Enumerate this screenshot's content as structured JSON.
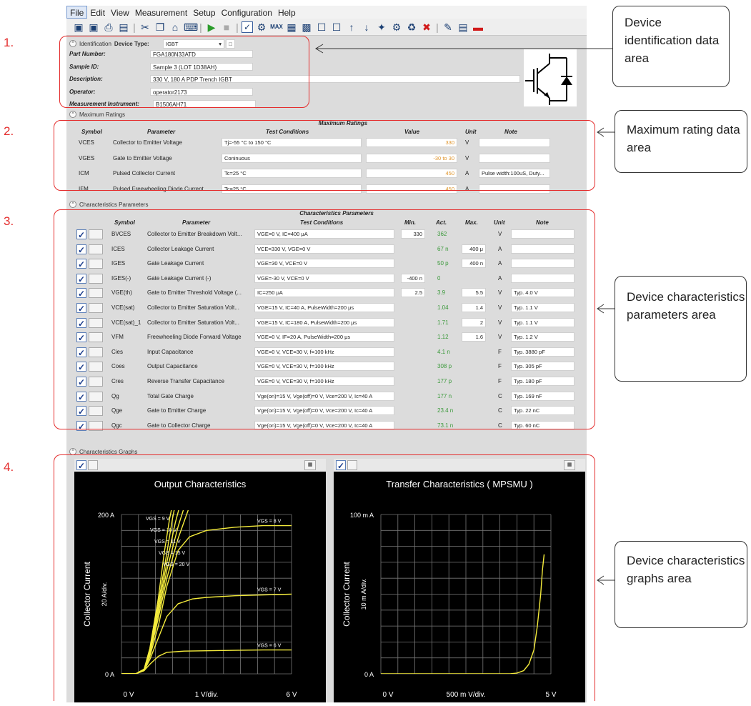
{
  "menu": [
    "File",
    "Edit",
    "View",
    "Measurement",
    "Setup",
    "Configuration",
    "Help"
  ],
  "toolbar_icons": [
    "save-icon",
    "save-as-icon",
    "print-icon",
    "open-icon",
    "cut-icon",
    "copy-icon",
    "paste-icon",
    "keyboard-icon",
    "run-icon",
    "stop-icon",
    "checkbox-icon",
    "settings-icon",
    "max-icon",
    "table-icon",
    "chart-icon",
    "export-icon",
    "import-icon",
    "up-arrow-icon",
    "down-arrow-icon",
    "wrench-icon",
    "config-icon",
    "refresh-icon",
    "delete-icon",
    "notes-icon",
    "document-icon",
    "color-icon"
  ],
  "identification": {
    "header": "Identification",
    "device_type_label": "Device Type:",
    "device_type_value": "IGBT",
    "fields": [
      {
        "label": "Part Number:",
        "value": "FGA180N33ATD"
      },
      {
        "label": "Sample ID:",
        "value": "Sample 3 (LOT 1D38AH)"
      },
      {
        "label": "Description:",
        "value": "330 V, 180 A PDP Trench IGBT"
      },
      {
        "label": "Operator:",
        "value": "operator2173"
      },
      {
        "label": "Measurement Instrument:",
        "value": "B1506AH71"
      }
    ]
  },
  "max_ratings": {
    "header": "Maximum Ratings",
    "title": "Maximum Ratings",
    "columns": [
      "Symbol",
      "Parameter",
      "Test Conditions",
      "Value",
      "Unit",
      "Note"
    ],
    "rows": [
      {
        "symbol": "VCES",
        "parameter": "Collector to Emitter Voltage",
        "conditions": "Tj=-55 °C to 150 °C",
        "value": "330",
        "unit": "V",
        "note": ""
      },
      {
        "symbol": "VGES",
        "parameter": "Gate to Emitter Voltage",
        "conditions": "Coninuous",
        "value": "-30  to 30",
        "unit": "V",
        "note": ""
      },
      {
        "symbol": "ICM",
        "parameter": "Pulsed Collector Current",
        "conditions": "Tc=25 °C",
        "value": "450",
        "unit": "A",
        "note": "Pulse width:100uS, Duty..."
      },
      {
        "symbol": "IFM",
        "parameter": "Pulsed Freewheeling Diode Current",
        "conditions": "Tc=25 °C",
        "value": "450",
        "unit": "A",
        "note": ""
      }
    ]
  },
  "char_params": {
    "header": "Characteristics Parameters",
    "title": "Characteristics Parameters",
    "columns": [
      "Symbol",
      "Parameter",
      "Test Conditions",
      "Min.",
      "Act.",
      "Max.",
      "Unit",
      "Note"
    ],
    "rows": [
      {
        "symbol": "BVCES",
        "parameter": "Collector to Emitter Breakdown Volt...",
        "conditions": "VGE=0 V, IC=400 μA",
        "min": "330",
        "act": "362",
        "max": "",
        "unit": "V",
        "note": ""
      },
      {
        "symbol": "ICES",
        "parameter": "Collector Leakage Current",
        "conditions": "VCE=330 V, VGE=0 V",
        "min": "",
        "act": "67 n",
        "max": "400 μ",
        "unit": "A",
        "note": ""
      },
      {
        "symbol": "IGES",
        "parameter": "Gate Leakage Current",
        "conditions": "VGE=30 V, VCE=0 V",
        "min": "",
        "act": "50 p",
        "max": "400 n",
        "unit": "A",
        "note": ""
      },
      {
        "symbol": "IGES(-)",
        "parameter": "Gate Leakage Current (-)",
        "conditions": "VGE=-30 V, VCE=0 V",
        "min": "-400 n",
        "act": "0",
        "max": "",
        "unit": "A",
        "note": ""
      },
      {
        "symbol": "VGE(th)",
        "parameter": "Gate to Emitter Threshold Voltage (...",
        "conditions": "IC=250 μA",
        "min": "2.5",
        "act": "3.9",
        "max": "5.5",
        "unit": "V",
        "note": "Typ. 4.0 V"
      },
      {
        "symbol": "VCE(sat)",
        "parameter": "Collector to Emitter Saturation Volt...",
        "conditions": "VGE=15 V, IC=40 A, PulseWidth=200 μs",
        "min": "",
        "act": "1.04",
        "max": "1.4",
        "unit": "V",
        "note": "Typ. 1.1 V"
      },
      {
        "symbol": "VCE(sat)_1",
        "parameter": "Collector to Emitter Saturation Volt...",
        "conditions": "VGE=15 V, IC=180 A, PulseWidth=200 μs",
        "min": "",
        "act": "1.71",
        "max": "2",
        "unit": "V",
        "note": "Typ. 1.1 V"
      },
      {
        "symbol": "VFM",
        "parameter": "Freewheeling Diode Forward Voltage",
        "conditions": "VGE=0 V, IF=20 A, PulseWidth=200 μs",
        "min": "",
        "act": "1.12",
        "max": "1.6",
        "unit": "V",
        "note": "Typ. 1.2 V"
      },
      {
        "symbol": "Cies",
        "parameter": "Input Capacitance",
        "conditions": "VGE=0 V, VCE=30 V, f=100 kHz",
        "min": "",
        "act": "4.1 n",
        "max": "",
        "unit": "F",
        "note": "Typ. 3880 pF"
      },
      {
        "symbol": "Coes",
        "parameter": "Output Capacitance",
        "conditions": "VGE=0 V, VCE=30 V, f=100 kHz",
        "min": "",
        "act": "308 p",
        "max": "",
        "unit": "F",
        "note": "Typ. 305 pF"
      },
      {
        "symbol": "Cres",
        "parameter": "Reverse Transfer Capacitance",
        "conditions": "VGE=0 V, VCE=30 V, f=100 kHz",
        "min": "",
        "act": "177 p",
        "max": "",
        "unit": "F",
        "note": "Typ. 180 pF"
      },
      {
        "symbol": "Qg",
        "parameter": "Total Gate Charge",
        "conditions": "Vge(on)=15 V, Vge(off)=0 V, Vce=200 V, Ic=40 A",
        "min": "",
        "act": "177 n",
        "max": "",
        "unit": "C",
        "note": "Typ. 169 nF"
      },
      {
        "symbol": "Qge",
        "parameter": "Gate to Emitter Charge",
        "conditions": "Vge(on)=15 V, Vge(off)=0 V, Vce=200 V, Ic=40 A",
        "min": "",
        "act": "23.4 n",
        "max": "",
        "unit": "C",
        "note": "Typ. 22 nC"
      },
      {
        "symbol": "Qgc",
        "parameter": "Gate to Collector Charge",
        "conditions": "Vge(on)=15 V, Vge(off)=0 V, Vce=200 V, Ic=40 A",
        "min": "",
        "act": "73.1 n",
        "max": "",
        "unit": "C",
        "note": "Typ. 60 nC"
      }
    ]
  },
  "graphs_header": "Characteristics Graphs",
  "chart_data": [
    {
      "type": "line",
      "title": "Output Characteristics",
      "xlabel": "1  V/div.",
      "ylabel": "Collector Current",
      "y_div_label": "20  A/div.",
      "x_tick_labels": [
        "0  V",
        "6  V"
      ],
      "y_tick_labels": [
        "0  A",
        "200  A"
      ],
      "xlim": [
        0,
        6
      ],
      "ylim": [
        0,
        200
      ],
      "grid": true,
      "line_color": "#f5ec3c",
      "series": [
        {
          "name": "VGS = 6 V",
          "x": [
            0,
            0.5,
            0.8,
            1.0,
            1.3,
            1.6,
            2.2,
            3,
            4,
            5,
            6
          ],
          "y": [
            0,
            0,
            4,
            12,
            22,
            27,
            28.5,
            29,
            29.5,
            30,
            30
          ]
        },
        {
          "name": "VGS = 7 V",
          "x": [
            0,
            0.5,
            0.8,
            1.0,
            1.3,
            1.6,
            2.0,
            2.5,
            3,
            4,
            5,
            6
          ],
          "y": [
            0,
            0,
            4,
            18,
            45,
            72,
            88,
            94,
            96,
            98,
            99,
            100
          ]
        },
        {
          "name": "VGS = 8 V",
          "x": [
            0,
            0.5,
            0.8,
            1.0,
            1.3,
            1.6,
            2.0,
            2.4,
            3.0,
            4.0,
            5.0,
            6.0
          ],
          "y": [
            0,
            0,
            4,
            22,
            60,
            110,
            155,
            172,
            180,
            184,
            186,
            186
          ]
        },
        {
          "name": "VGS = 9 V",
          "x": [
            0,
            0.5,
            0.8,
            1.0,
            1.3,
            1.6,
            2.0,
            2.3,
            2.6
          ],
          "y": [
            0,
            0,
            5,
            25,
            70,
            120,
            170,
            200,
            230
          ]
        },
        {
          "name": "VGS = 10 V",
          "x": [
            0,
            0.5,
            0.8,
            1.0,
            1.3,
            1.6,
            2.0,
            2.4
          ],
          "y": [
            0,
            0,
            5,
            27,
            76,
            130,
            185,
            230
          ]
        },
        {
          "name": "VGS = 11 V",
          "x": [
            0,
            0.5,
            0.8,
            1.0,
            1.3,
            1.6,
            1.9,
            2.2
          ],
          "y": [
            0,
            0,
            5,
            28,
            82,
            140,
            190,
            230
          ]
        },
        {
          "name": "VGS = 15 V",
          "x": [
            0,
            0.5,
            0.8,
            1.0,
            1.3,
            1.6,
            1.8,
            2.0
          ],
          "y": [
            0,
            0,
            6,
            30,
            88,
            152,
            195,
            230
          ]
        },
        {
          "name": "VGS = 20 V",
          "x": [
            0,
            0.5,
            0.8,
            1.0,
            1.3,
            1.5,
            1.7,
            1.9
          ],
          "y": [
            0,
            0,
            6,
            32,
            95,
            150,
            195,
            230
          ]
        }
      ]
    },
    {
      "type": "line",
      "title": "Transfer Characteristics ( MPSMU )",
      "xlabel": "500 m  V/div.",
      "ylabel": "Collector Current",
      "y_div_label": "10 m  A/div.",
      "x_tick_labels": [
        "0  V",
        "5  V"
      ],
      "y_tick_labels": [
        "0  A",
        "100 m  A"
      ],
      "xlim": [
        0,
        5
      ],
      "ylim": [
        0,
        0.1
      ],
      "grid": true,
      "line_color": "#f5ec3c",
      "series": [
        {
          "x": [
            0,
            3.0,
            3.8,
            4.0,
            4.2,
            4.35,
            4.5,
            4.6,
            4.7,
            4.75,
            4.8
          ],
          "y": [
            0,
            0,
            0,
            0.0005,
            0.002,
            0.006,
            0.015,
            0.03,
            0.05,
            0.065,
            0.075
          ]
        }
      ]
    }
  ],
  "annotations": {
    "numbers": [
      "1.",
      "2.",
      "3.",
      "4."
    ],
    "callouts": [
      "Device identification data area",
      "Maximum rating data area",
      "Device characteristics parameters area",
      "Device characteristics graphs area"
    ]
  },
  "colors": {
    "frame": "#e42d2d",
    "plot_line": "#f5ec3c",
    "value_orange": "#e0952c",
    "value_green": "#3c9a3c"
  }
}
